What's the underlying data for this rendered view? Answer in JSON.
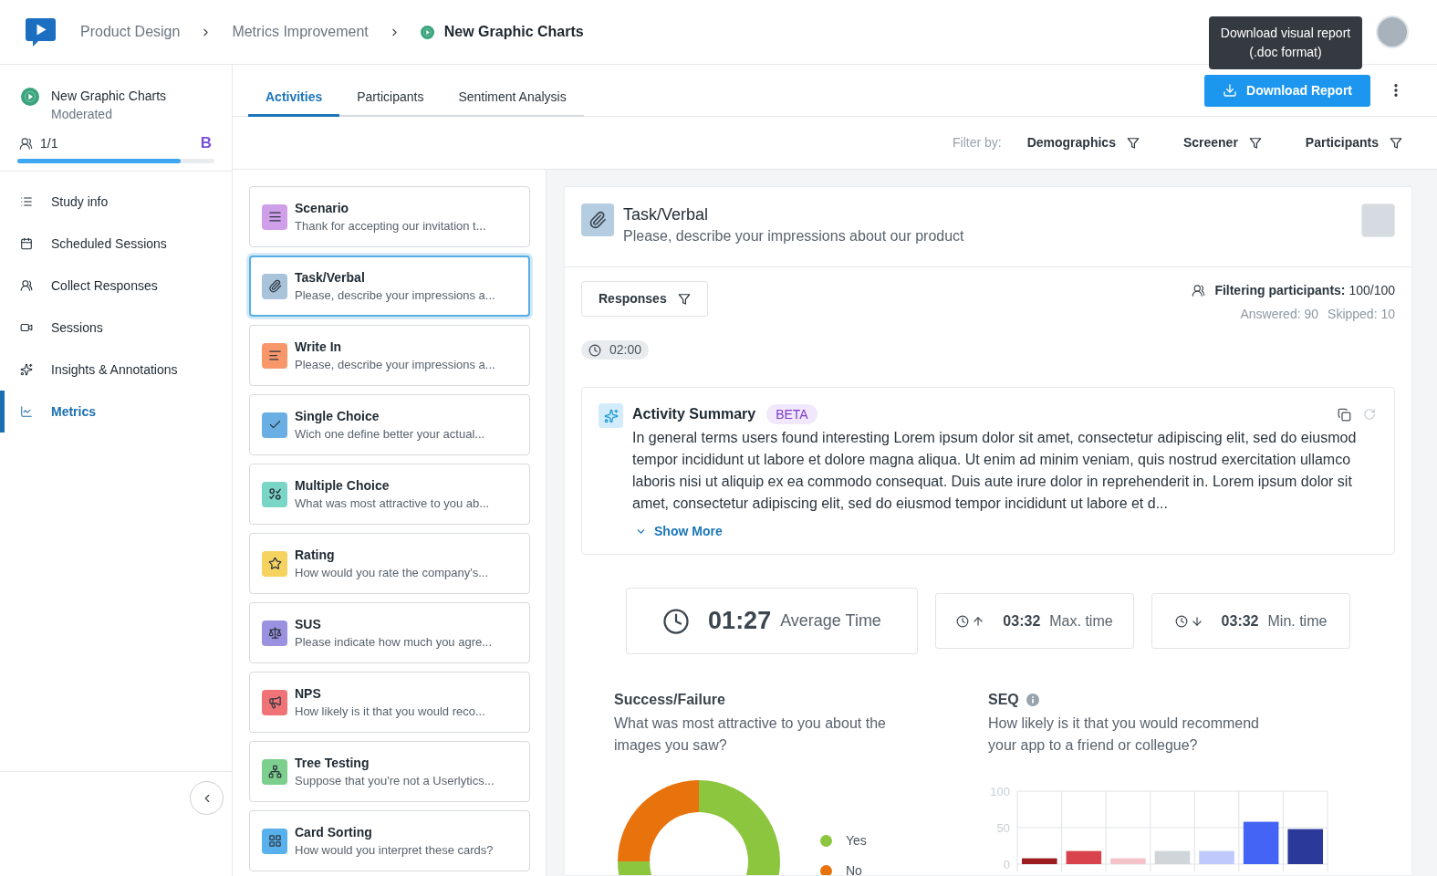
{
  "header": {
    "breadcrumbs": [
      {
        "label": "Product Design",
        "current": false
      },
      {
        "label": "Metrics Improvement",
        "current": false
      },
      {
        "label": "New Graphic Charts",
        "current": true
      }
    ],
    "tooltip": {
      "lines": [
        "Download visual report",
        "(.doc format)"
      ]
    }
  },
  "sidebar": {
    "study": {
      "title": "New Graphic Charts",
      "subtitle": "Moderated",
      "count": "1/1",
      "badge": "B",
      "level": 0.83
    },
    "items": [
      {
        "kind": "info",
        "label": "Study info",
        "selected": false
      },
      {
        "kind": "scheduled",
        "label": "Scheduled Sessions",
        "selected": false
      },
      {
        "kind": "collect",
        "label": "Collect Responses",
        "selected": false
      },
      {
        "kind": "sessions",
        "label": "Sessions",
        "selected": false
      },
      {
        "kind": "insights",
        "label": "Insights & Annotations",
        "selected": false
      },
      {
        "kind": "metrics",
        "label": "Metrics",
        "selected": true
      }
    ]
  },
  "tabs": [
    {
      "label": "Activities",
      "selected": true
    },
    {
      "label": "Participants",
      "selected": false
    },
    {
      "label": "Sentiment Analysis",
      "selected": false
    }
  ],
  "toolbar": {
    "download_button": "Download Report"
  },
  "filters": {
    "label": "Filter by:",
    "items": [
      "Demographics",
      "Screener",
      "Participants"
    ]
  },
  "activities": [
    {
      "kind": "scenario",
      "title": "Scenario",
      "subtitle": "Thank for accepting our invitation t...",
      "color": "#cf9fea",
      "selected": false
    },
    {
      "kind": "task",
      "title": "Task/Verbal",
      "subtitle": "Please, describe your impressions a...",
      "color": "#a8c3da",
      "selected": true
    },
    {
      "kind": "write_in",
      "title": "Write In",
      "subtitle": "Please, describe your impressions a...",
      "color": "#f7976a",
      "selected": false
    },
    {
      "kind": "single_choice",
      "title": "Single Choice",
      "subtitle": "Wich one define better your actual...",
      "color": "#6aafe3",
      "selected": false
    },
    {
      "kind": "multiple_choice",
      "title": "Multiple Choice",
      "subtitle": "What was most attractive to you ab...",
      "color": "#79d6c6",
      "selected": false
    },
    {
      "kind": "rating",
      "title": "Rating",
      "subtitle": "How would you rate the company's...",
      "color": "#f6d25f",
      "selected": false
    },
    {
      "kind": "sus",
      "title": "SUS",
      "subtitle": "Please indicate how much you agre...",
      "color": "#9a91e1",
      "selected": false
    },
    {
      "kind": "nps",
      "title": "NPS",
      "subtitle": "How likely is it that you would reco...",
      "color": "#f07378",
      "selected": false
    },
    {
      "kind": "tree_testing",
      "title": "Tree Testing",
      "subtitle": "Suppose that you're not a Userlytics...",
      "color": "#7ccf8c",
      "selected": false
    },
    {
      "kind": "card_sorting",
      "title": "Card Sorting",
      "subtitle": "How would you interpret these cards?",
      "color": "#58b1ec",
      "selected": false
    }
  ],
  "detail": {
    "title": "Task/Verbal",
    "subtitle": "Please, describe your impressions about our product",
    "responses_button": "Responses",
    "filtering": "**Filtering participants:** 100/100",
    "answered": "Answered: 90",
    "skipped": "Skipped: 10",
    "timer": "02:00",
    "summary": {
      "title": "Activity Summary",
      "badge": "BETA",
      "text": "In general terms users found interesting Lorem ipsum dolor sit amet, consectetur adipiscing elit, sed do eiusmod tempor incididunt ut labore et dolore magna aliqua. Ut enim ad minim veniam, quis nostrud exercitation ullamco laboris nisi ut aliquip ex ea commodo consequat. Duis aute irure dolor in reprehenderit in. Lorem ipsum dolor sit amet, consectetur adipiscing elit, sed do eiusmod tempor incididunt ut labore et d...",
      "show_more": "Show More"
    },
    "stats": [
      {
        "kind": "average",
        "value": "01:27",
        "label": "Average Time"
      },
      {
        "kind": "max",
        "value": "03:32",
        "label": "Max. time"
      },
      {
        "kind": "min",
        "value": "03:32",
        "label": "Min. time"
      }
    ],
    "success_chart": {
      "title": "Success/Failure",
      "question": "What was most attractive to you about the images you saw?",
      "legend": [
        {
          "label": "Yes",
          "color": "#8cc63f"
        },
        {
          "label": "No",
          "color": "#e8730c"
        }
      ]
    },
    "seq_chart": {
      "title": "SEQ",
      "question": "How likely is it that you would recommend your app to a friend or collegue?",
      "chart_data": {
        "type": "bar",
        "values": [
          8,
          18,
          8,
          18,
          18,
          58,
          48
        ],
        "colors": [
          "#9b1d20",
          "#d8434c",
          "#f4c3c9",
          "#cfd5d9",
          "#bfc9fb",
          "#4364f5",
          "#2b3a9a"
        ],
        "ylim": [
          0,
          100
        ],
        "yticks": [
          0,
          50,
          100
        ]
      }
    }
  }
}
